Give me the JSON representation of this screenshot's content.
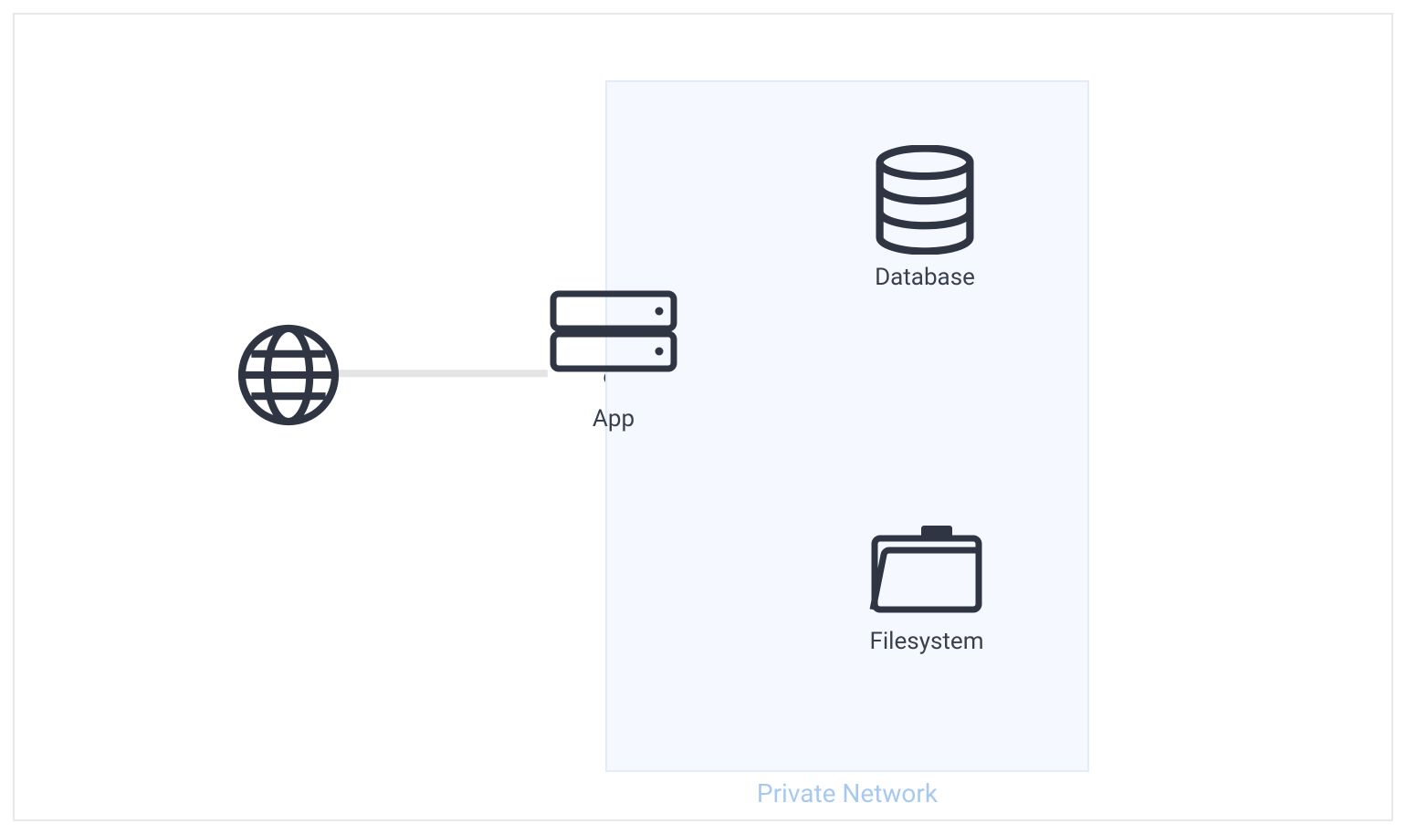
{
  "diagram": {
    "nodes": {
      "internet": {
        "label": ""
      },
      "app": {
        "label": "App"
      },
      "database": {
        "label": "Database"
      },
      "filesystem": {
        "label": "Filesystem"
      }
    },
    "zone": {
      "private_network_label": "Private Network"
    },
    "colors": {
      "icon_stroke": "#2f3542",
      "connector": "#e4e4e4",
      "zone_bg": "#f5f9ff",
      "zone_border": "#e0ecfa",
      "zone_label": "#a8c9ef"
    }
  }
}
